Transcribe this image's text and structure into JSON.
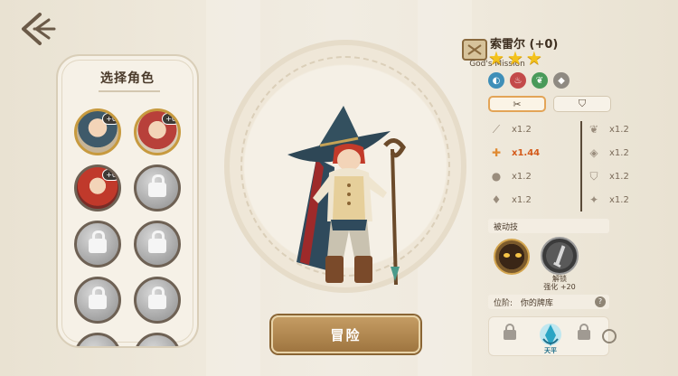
{
  "left_panel": {
    "title": "选择角色",
    "slots": [
      {
        "state": "owned",
        "badge": "+0"
      },
      {
        "state": "owned",
        "badge": "+0"
      },
      {
        "state": "owned",
        "badge": "+0"
      },
      {
        "state": "locked"
      },
      {
        "state": "locked"
      },
      {
        "state": "locked"
      },
      {
        "state": "locked"
      },
      {
        "state": "locked"
      }
    ]
  },
  "center": {
    "adventure_label": "冒险"
  },
  "hero": {
    "name": "索雷尔 (+0)",
    "stars": 3,
    "mission_label": "God's Mission",
    "elements": [
      "water-icon",
      "fire-icon",
      "leaf-icon",
      "crystal-icon"
    ],
    "tabs": [
      "tools-icon",
      "shield-icon"
    ],
    "stats_left": [
      {
        "icon": "feather-icon",
        "value": "x1.2"
      },
      {
        "icon": "axe-icon",
        "value": "x1.44",
        "highlight": true
      },
      {
        "icon": "drop-icon",
        "value": "x1.2"
      },
      {
        "icon": "flame-icon",
        "value": "x1.2"
      }
    ],
    "stats_right": [
      {
        "icon": "leaf-icon",
        "value": "x1.2"
      },
      {
        "icon": "diamond-icon",
        "value": "x1.2"
      },
      {
        "icon": "shield-icon",
        "value": "x1.2"
      },
      {
        "icon": "sparkle-icon",
        "value": "x1.2"
      }
    ],
    "passive_label": "被动技",
    "skill2_unlock": "解锁",
    "skill2_enhance": "强化 +20",
    "rank_label": "位阶:",
    "rank_value": "你的牌库",
    "deck_card_label": "天平"
  },
  "colors": {
    "accent": "#c49c63",
    "star": "#f3c21b",
    "highlight": "#d45a1a"
  }
}
